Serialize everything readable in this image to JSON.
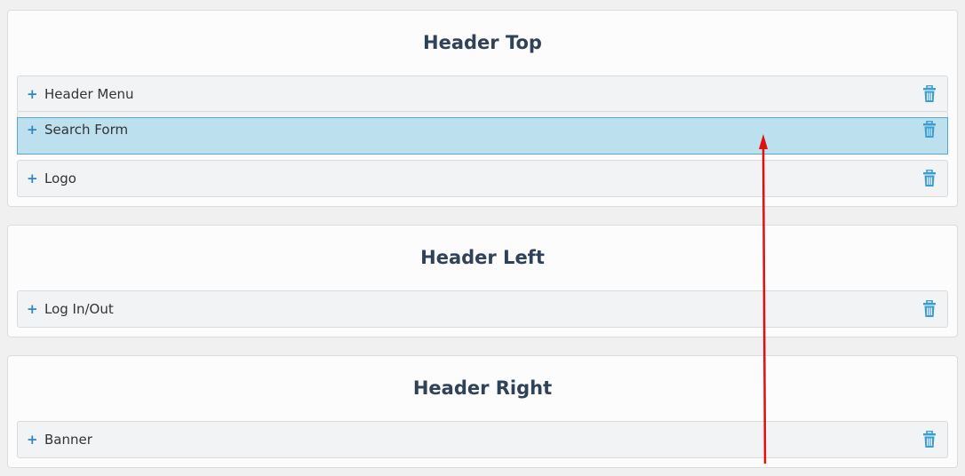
{
  "sections": [
    {
      "title": "Header Top",
      "items": [
        {
          "label": "Header Menu",
          "plus": "+"
        },
        {
          "label": "Search Form",
          "plus": "+",
          "dragging": true
        },
        {
          "label": "Logo",
          "plus": "+"
        }
      ]
    },
    {
      "title": "Header Left",
      "items": [
        {
          "label": "Log In/Out",
          "plus": "+"
        }
      ]
    },
    {
      "title": "Header Right",
      "items": [
        {
          "label": "Banner",
          "plus": "+"
        }
      ]
    }
  ],
  "colors": {
    "accent": "#2e86c9",
    "trash": "#3a9fd0",
    "drag_highlight": "#bde0ee",
    "arrow": "#e01010",
    "title": "#2f4257"
  },
  "icons": {
    "expand": "plus-icon",
    "delete": "trash-icon",
    "annotation": "red-arrow-up"
  }
}
